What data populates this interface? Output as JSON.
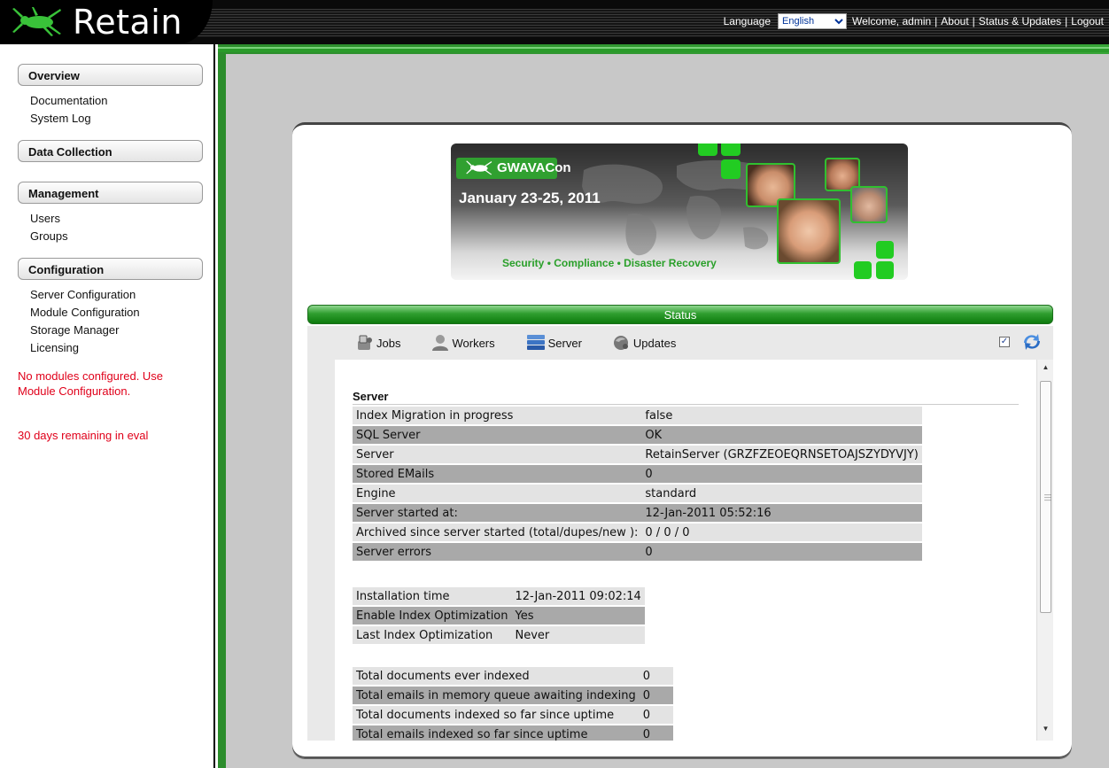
{
  "app": {
    "name": "Retain"
  },
  "header": {
    "language_label": "Language",
    "language_selected": "English",
    "links": [
      "Welcome, admin",
      "About",
      "Status & Updates",
      "Logout"
    ]
  },
  "sidebar": {
    "sections": [
      {
        "title": "Overview",
        "items": [
          "Documentation",
          "System Log"
        ]
      },
      {
        "title": "Data Collection",
        "items": []
      },
      {
        "title": "Management",
        "items": [
          "Users",
          "Groups"
        ]
      },
      {
        "title": "Configuration",
        "items": [
          "Server Configuration",
          "Module Configuration",
          "Storage Manager",
          "Licensing"
        ]
      }
    ],
    "warning_modules": "No modules configured. Use Module Configuration.",
    "warning_eval": "30 days remaining in eval"
  },
  "banner": {
    "brand": "GWAVACon",
    "date": "January 23-25, 2011",
    "tagline": "Security • Compliance • Disaster Recovery"
  },
  "status": {
    "title": "Status",
    "tabs": [
      {
        "label": "Jobs",
        "icon": "jobs-icon"
      },
      {
        "label": "Workers",
        "icon": "workers-icon"
      },
      {
        "label": "Server",
        "icon": "server-icon"
      },
      {
        "label": "Updates",
        "icon": "updates-icon"
      }
    ],
    "auto_refresh_checked": true
  },
  "server": {
    "heading": "Server",
    "rows": [
      {
        "key": "Index Migration in progress",
        "value": "false"
      },
      {
        "key": "SQL Server",
        "value": "OK"
      },
      {
        "key": "Server",
        "value": "RetainServer (GRZFZEOEQRNSETOAJSZYDYVJY)"
      },
      {
        "key": "Stored EMails",
        "value": "0"
      },
      {
        "key": "Engine",
        "value": "standard"
      },
      {
        "key": "Server started at:",
        "value": "12-Jan-2011 05:52:16"
      },
      {
        "key": "Archived since server started (total/dupes/new ):",
        "value": "0 / 0 / 0"
      },
      {
        "key": "Server errors",
        "value": "0"
      }
    ],
    "index_rows": [
      {
        "key": "Installation time",
        "value": "12-Jan-2011 09:02:14"
      },
      {
        "key": "Enable Index Optimization",
        "value": "Yes"
      },
      {
        "key": "Last Index Optimization",
        "value": "Never"
      }
    ],
    "doc_rows": [
      {
        "key": "Total documents ever indexed",
        "value": "0"
      },
      {
        "key": "Total emails in memory queue awaiting indexing",
        "value": "0"
      },
      {
        "key": "Total documents indexed so far since uptime",
        "value": "0"
      },
      {
        "key": "Total emails indexed so far since uptime",
        "value": "0"
      }
    ]
  },
  "colors": {
    "accent_green": "#2f9e2f",
    "warning_red": "#e0001a",
    "workspace_gray": "#c8c8c8"
  }
}
